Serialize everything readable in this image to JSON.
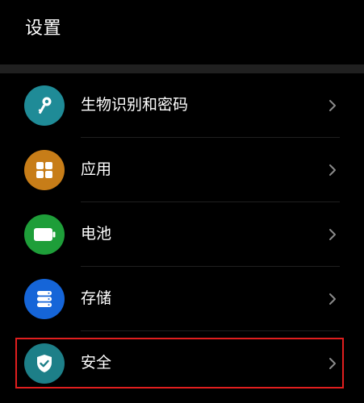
{
  "header": {
    "title": "设置"
  },
  "list": {
    "items": [
      {
        "label": "生物识别和密码",
        "icon": "key-icon",
        "color": "#1f8b97"
      },
      {
        "label": "应用",
        "icon": "apps-grid-icon",
        "color": "#c77d18"
      },
      {
        "label": "电池",
        "icon": "battery-icon",
        "color": "#1e9e39"
      },
      {
        "label": "存储",
        "icon": "storage-icon",
        "color": "#1565d8"
      },
      {
        "label": "安全",
        "icon": "shield-check-icon",
        "color": "#1d7f88"
      }
    ]
  },
  "colors": {
    "background": "#000000",
    "highlight": "#e01e1e",
    "separator_band": "#202020",
    "chevron": "#8a8a8a"
  }
}
